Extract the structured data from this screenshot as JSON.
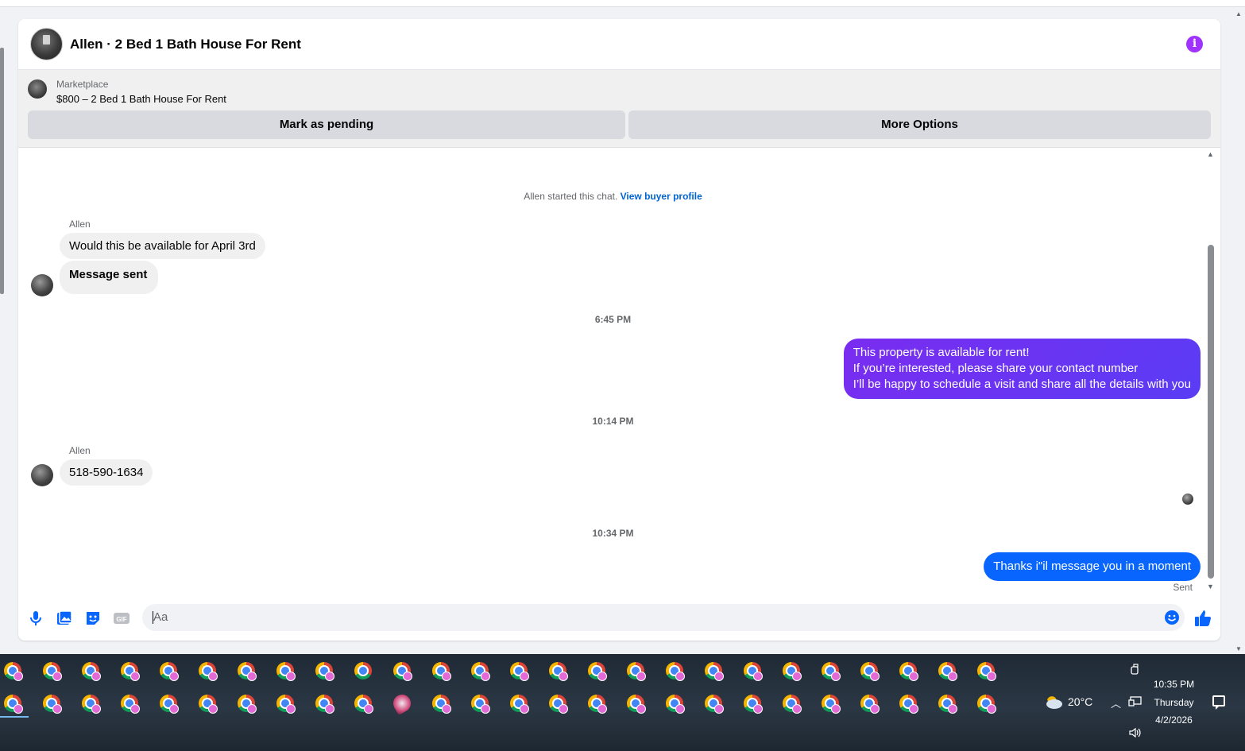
{
  "conversation": {
    "title": "Allen · 2 Bed 1 Bath House For Rent"
  },
  "marketplace": {
    "label": "Marketplace",
    "listing": "$800 – 2 Bed 1 Bath House For Rent",
    "mark_pending_label": "Mark as pending",
    "more_options_label": "More Options"
  },
  "chat": {
    "system_text": "Allen started this chat.",
    "view_profile_link": "View buyer profile",
    "messages": [
      {
        "sender": "Allen",
        "text": "Would this be available for April 3rd"
      },
      {
        "text": "Message sent"
      },
      {
        "timestamp": "6:45 PM"
      },
      {
        "lines": [
          "This property is available for rent!",
          "If you’re interested, please share your contact number",
          "I’ll be happy to schedule a visit and share all the details with you"
        ]
      },
      {
        "timestamp": "10:14 PM"
      },
      {
        "sender": "Allen",
        "text": "518-590-1634"
      },
      {
        "timestamp": "10:34 PM"
      },
      {
        "text": "Thanks i\"il message you in a moment",
        "status": "Sent"
      }
    ]
  },
  "composer": {
    "placeholder": "Aa",
    "icons": [
      "microphone-icon",
      "photo-icon",
      "sticker-icon",
      "gif-icon",
      "emoji-icon",
      "thumbs-up-icon"
    ],
    "gif_label": "GIF"
  },
  "taskbar": {
    "weather_temp": "20°C",
    "time": "10:35 PM",
    "day": "Thursday",
    "date": "4/2/2026"
  },
  "colors": {
    "accent_blue": "#0866ff",
    "outgoing_purple": "#6a34f2",
    "info_purple": "#a033ff",
    "link_blue": "#0064d1"
  }
}
